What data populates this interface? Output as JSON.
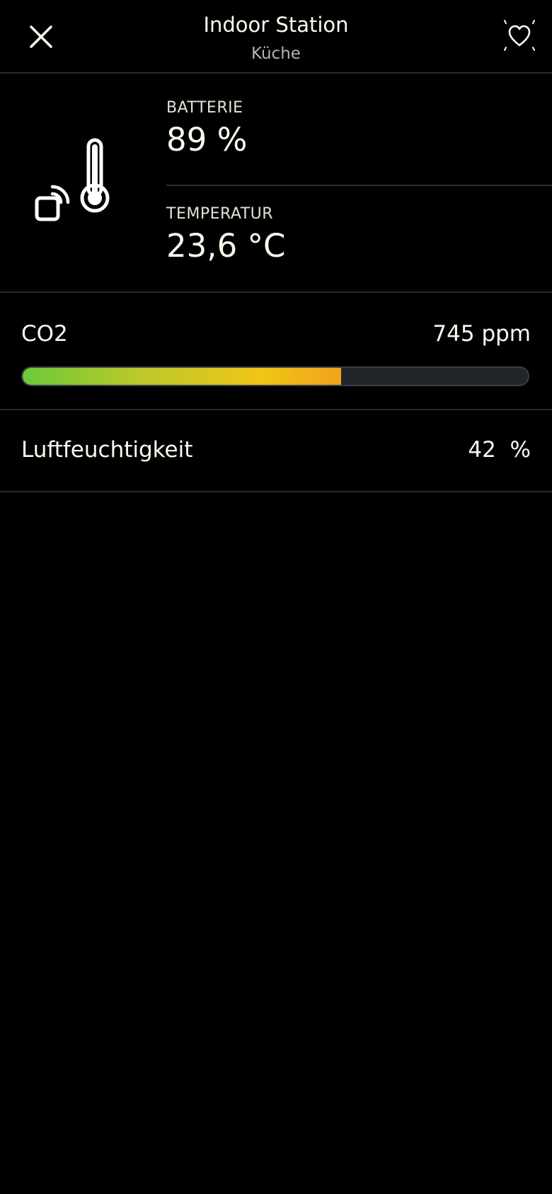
{
  "header": {
    "title": "Indoor Station",
    "subtitle": "Küche",
    "close_icon": "close-icon",
    "favorite_icon": "heart-icon"
  },
  "device": {
    "icon": "thermometer-wireless-icon",
    "battery_label": "BATTERIE",
    "battery_value": "89 %",
    "temperature_label": "TEMPERATUR",
    "temperature_value": "23,6 °C"
  },
  "co2": {
    "label": "CO2",
    "value": "745 ppm",
    "level_fraction": 0.63,
    "colors": [
      "#6cc93a",
      "#f0c517",
      "#f0a21c"
    ]
  },
  "humidity": {
    "label": "Luftfeuchtigkeit",
    "value": "42  %"
  }
}
